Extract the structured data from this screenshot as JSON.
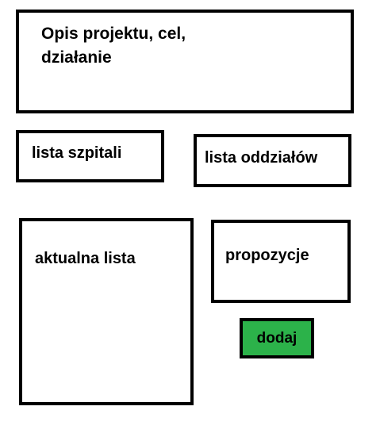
{
  "project_description": {
    "line1": "Opis projektu, cel,",
    "line2": "działanie"
  },
  "hospitals_list": {
    "label": "lista szpitali"
  },
  "departments_list": {
    "label": "lista oddziałów"
  },
  "current_list": {
    "label": "aktualna lista"
  },
  "proposals": {
    "label": "propozycje"
  },
  "add_button": {
    "label": "dodaj",
    "color": "#2cb24a"
  }
}
